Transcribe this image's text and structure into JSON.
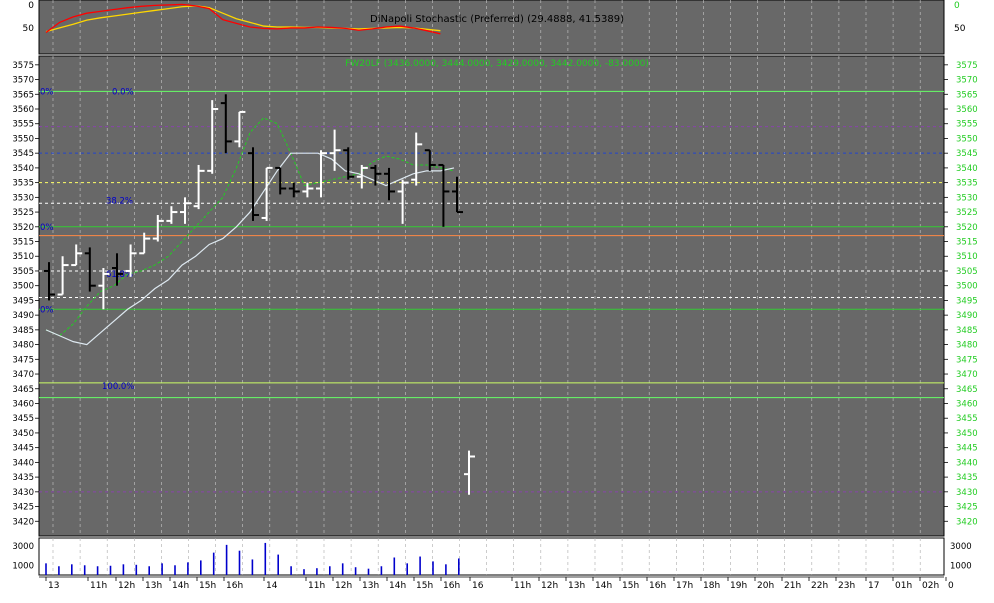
{
  "stoch_panel": {
    "title": "DiNapoli Stochastic (Preferred) (29.4888, 41.5389)",
    "left_ticks": [
      {
        "label": "0",
        "v": 100
      },
      {
        "label": "50",
        "v": 50
      }
    ],
    "right_ticks": [
      {
        "label": "0",
        "v": 100
      },
      {
        "label": "50",
        "v": 50
      }
    ]
  },
  "price_panel": {
    "instrument_label": "FW20LF (3436.0000, 3444.0000, 3429.0000, 3442.0000, -83.0000)",
    "fib_labels": [
      {
        "text": "0.0%",
        "y": 3566
      },
      {
        "text": "38.2%",
        "y": 3529
      },
      {
        "text": "61.8%",
        "y": 3504
      },
      {
        "text": "100.0%",
        "y": 3466
      }
    ],
    "edge_labels": [
      {
        "text": "0%",
        "y": 3566
      },
      {
        "text": "0%",
        "y": 3520
      },
      {
        "text": "0%",
        "y": 3492
      }
    ]
  },
  "volume_panel": {
    "ticks": [
      "3000",
      "1000"
    ]
  },
  "x_axis": {
    "labels": [
      "13",
      "11h",
      "12h",
      "13h",
      "14h",
      "15h",
      "16h",
      "14",
      "11h",
      "12h",
      "13h",
      "14h",
      "15h",
      "16h",
      "16",
      "11h",
      "12h",
      "13h",
      "14h",
      "15h",
      "16h",
      "17h",
      "18h",
      "19h",
      "20h",
      "21h",
      "22h",
      "23h",
      "17",
      "01h",
      "02h",
      "0"
    ]
  },
  "colors": {
    "background": "#686868",
    "grid": "#c8c8c8",
    "up_bar": "#ffffff",
    "down_bar": "#000000",
    "stoch_fast": "#ff0000",
    "stoch_slow": "#ffd700",
    "ma_solid": "#dde8f0",
    "ma_dashed": "#22cc22",
    "axis_text_right": "#22cc22",
    "fib_text": "#0000cc",
    "volume_bar": "#0000cc"
  },
  "chart_data": {
    "type": "ohlc",
    "ylim": [
      3415,
      3578
    ],
    "yticks": [
      3420,
      3425,
      3430,
      3435,
      3440,
      3445,
      3450,
      3455,
      3460,
      3465,
      3470,
      3475,
      3480,
      3485,
      3490,
      3495,
      3500,
      3505,
      3510,
      3515,
      3520,
      3525,
      3530,
      3535,
      3540,
      3545,
      3550,
      3555,
      3560,
      3565,
      3570,
      3575
    ],
    "bars": [
      {
        "o": 3505,
        "h": 3508,
        "l": 3495,
        "c": 3497
      },
      {
        "o": 3497,
        "h": 3510,
        "l": 3497,
        "c": 3507
      },
      {
        "o": 3507,
        "h": 3514,
        "l": 3507,
        "c": 3511
      },
      {
        "o": 3511,
        "h": 3513,
        "l": 3498,
        "c": 3500
      },
      {
        "o": 3500,
        "h": 3506,
        "l": 3492,
        "c": 3504
      },
      {
        "o": 3506,
        "h": 3511,
        "l": 3500,
        "c": 3504
      },
      {
        "o": 3505,
        "h": 3514,
        "l": 3503,
        "c": 3511
      },
      {
        "o": 3511,
        "h": 3518,
        "l": 3511,
        "c": 3516
      },
      {
        "o": 3516,
        "h": 3524,
        "l": 3515,
        "c": 3522
      },
      {
        "o": 3522,
        "h": 3527,
        "l": 3521,
        "c": 3525
      },
      {
        "o": 3525,
        "h": 3530,
        "l": 3521,
        "c": 3528
      },
      {
        "o": 3527,
        "h": 3541,
        "l": 3526,
        "c": 3539
      },
      {
        "o": 3539,
        "h": 3563,
        "l": 3538,
        "c": 3560
      },
      {
        "o": 3562,
        "h": 3565,
        "l": 3545,
        "c": 3549
      },
      {
        "o": 3549,
        "h": 3559,
        "l": 3547,
        "c": 3559
      },
      {
        "o": 3545,
        "h": 3547,
        "l": 3522,
        "c": 3524
      },
      {
        "o": 3523,
        "h": 3540,
        "l": 3522,
        "c": 3540
      },
      {
        "o": 3540,
        "h": 3540,
        "l": 3531,
        "c": 3533
      },
      {
        "o": 3533,
        "h": 3535,
        "l": 3530,
        "c": 3532
      },
      {
        "o": 3532,
        "h": 3535,
        "l": 3530,
        "c": 3533
      },
      {
        "o": 3533,
        "h": 3546,
        "l": 3530,
        "c": 3545
      },
      {
        "o": 3545,
        "h": 3553,
        "l": 3539,
        "c": 3546
      },
      {
        "o": 3546,
        "h": 3547,
        "l": 3536,
        "c": 3537
      },
      {
        "o": 3537,
        "h": 3541,
        "l": 3533,
        "c": 3540
      },
      {
        "o": 3540,
        "h": 3541,
        "l": 3534,
        "c": 3538
      },
      {
        "o": 3538,
        "h": 3540,
        "l": 3529,
        "c": 3532
      },
      {
        "o": 3532,
        "h": 3536,
        "l": 3521,
        "c": 3535
      },
      {
        "o": 3536,
        "h": 3552,
        "l": 3534,
        "c": 3548
      },
      {
        "o": 3546,
        "h": 3546,
        "l": 3539,
        "c": 3541
      },
      {
        "o": 3541,
        "h": 3541,
        "l": 3520,
        "c": 3532
      },
      {
        "o": 3532,
        "h": 3537,
        "l": 3525,
        "c": 3525
      },
      {
        "o": 3436,
        "h": 3444,
        "l": 3429,
        "c": 3442
      }
    ],
    "ma_solid": [
      3485,
      3483,
      3481,
      3480,
      3484,
      3488,
      3492,
      3495,
      3499,
      3502,
      3507,
      3510,
      3514,
      3516,
      3520,
      3525,
      3532,
      3539,
      3545,
      3545,
      3545,
      3543,
      3539,
      3538,
      3536,
      3534,
      3536,
      3538,
      3539,
      3539,
      3540
    ],
    "ma_dashed": [
      3485,
      3483,
      3487,
      3493,
      3498,
      3500,
      3504,
      3505,
      3507,
      3510,
      3515,
      3520,
      3525,
      3530,
      3540,
      3552,
      3557,
      3555,
      3545,
      3534,
      3535,
      3536,
      3537,
      3538,
      3542,
      3544,
      3543,
      3541,
      3541,
      3540,
      3539
    ],
    "stoch_fast": [
      38,
      60,
      72,
      80,
      84,
      88,
      92,
      95,
      97,
      98,
      99,
      96,
      90,
      66,
      58,
      50,
      47,
      46,
      48,
      48,
      50,
      49,
      47,
      43,
      46,
      50,
      52,
      48,
      42,
      35
    ],
    "stoch_slow": [
      40,
      48,
      56,
      65,
      70,
      74,
      78,
      82,
      86,
      90,
      94,
      96,
      92,
      80,
      68,
      60,
      52,
      50,
      50,
      49,
      49,
      48,
      47,
      46,
      47,
      48,
      49,
      48,
      45,
      42
    ],
    "volume_ticks": [
      {
        "label": "3000",
        "v": 3000
      },
      {
        "label": "1000",
        "v": 1000
      }
    ],
    "volume": [
      1200,
      900,
      1100,
      1000,
      900,
      950,
      1100,
      1050,
      900,
      1200,
      1000,
      1300,
      1500,
      2300,
      3100,
      2500,
      1600,
      3300,
      2100,
      900,
      600,
      700,
      900,
      1200,
      800,
      650,
      900,
      1800,
      1200,
      1900,
      1400,
      1100,
      1700
    ],
    "hlines": [
      {
        "y": 3566,
        "color": "#66ff66",
        "style": "solid"
      },
      {
        "y": 3554,
        "color": "#8844aa",
        "style": "dash"
      },
      {
        "y": 3545,
        "color": "#2244cc",
        "style": "dash"
      },
      {
        "y": 3535,
        "color": "#ffff66",
        "style": "dash"
      },
      {
        "y": 3528,
        "color": "#ffffff",
        "style": "dash"
      },
      {
        "y": 3520,
        "color": "#33cc33",
        "style": "solid"
      },
      {
        "y": 3517,
        "color": "#ff8844",
        "style": "solid"
      },
      {
        "y": 3505,
        "color": "#ffffff",
        "style": "dash"
      },
      {
        "y": 3496,
        "color": "#ffffff",
        "style": "dash"
      },
      {
        "y": 3492,
        "color": "#33cc33",
        "style": "solid"
      },
      {
        "y": 3467,
        "color": "#ccff66",
        "style": "solid"
      },
      {
        "y": 3462,
        "color": "#66ff66",
        "style": "solid"
      },
      {
        "y": 3430,
        "color": "#8844aa",
        "style": "dash"
      }
    ]
  }
}
